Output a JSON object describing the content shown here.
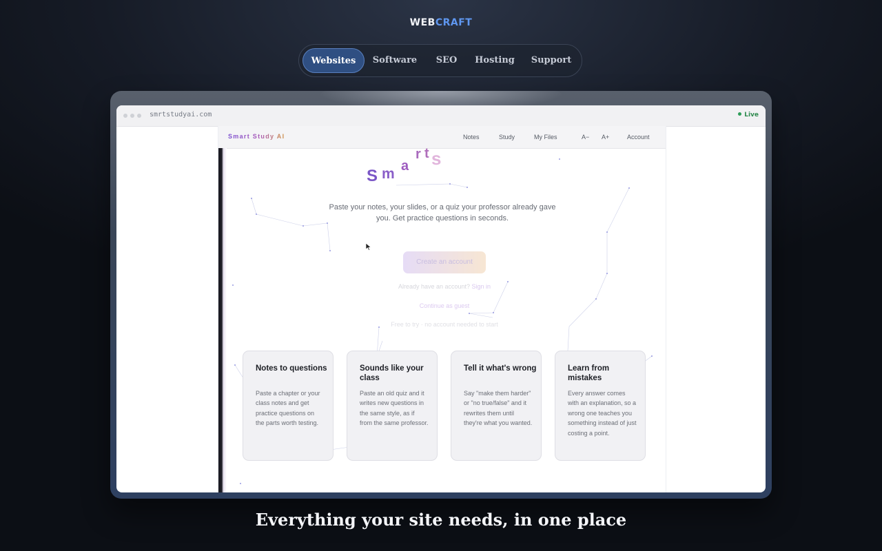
{
  "brand": {
    "part1": "WEB",
    "part2": "CRAFT"
  },
  "nav": {
    "items": [
      {
        "label": "Websites",
        "active": true
      },
      {
        "label": "Software",
        "active": false
      },
      {
        "label": "SEO",
        "active": false
      },
      {
        "label": "Hosting",
        "active": false
      },
      {
        "label": "Support",
        "active": false
      }
    ]
  },
  "browser": {
    "url": "smrtstudyai.com",
    "status": "Live"
  },
  "site": {
    "logo": "Smart Study AI",
    "nav": [
      "Notes",
      "Study",
      "My Files",
      "A−",
      "A+",
      "Account"
    ],
    "hero_letters": [
      "S",
      "m",
      "a",
      "r",
      "t",
      "s"
    ],
    "tagline": "Paste your notes, your slides, or a quiz your professor already gave you. Get practice questions in seconds.",
    "cta": "Create an account",
    "signin_prompt": "Already have an account?",
    "signin_link": "Sign in",
    "guest": "Continue as guest",
    "free_note": "Free to try · no account needed to start",
    "cards": [
      {
        "title": "Notes to questions",
        "body": "Paste a chapter or your class notes and get practice questions on the parts worth testing."
      },
      {
        "title": "Sounds like your class",
        "body": "Paste an old quiz and it writes new questions in the same style, as if from the same professor."
      },
      {
        "title": "Tell it what's wrong",
        "body": "Say \"make them harder\" or \"no true/false\" and it rewrites them until they're what you wanted."
      },
      {
        "title": "Learn from mistakes",
        "body": "Every answer comes with an explanation, so a wrong one teaches you something instead of just costing a point."
      }
    ]
  },
  "caption": "Everything your site needs, in one place",
  "colors": {
    "accent": "#5f97f0",
    "nav_active": "#2f4f82",
    "live": "#2e9d58"
  }
}
